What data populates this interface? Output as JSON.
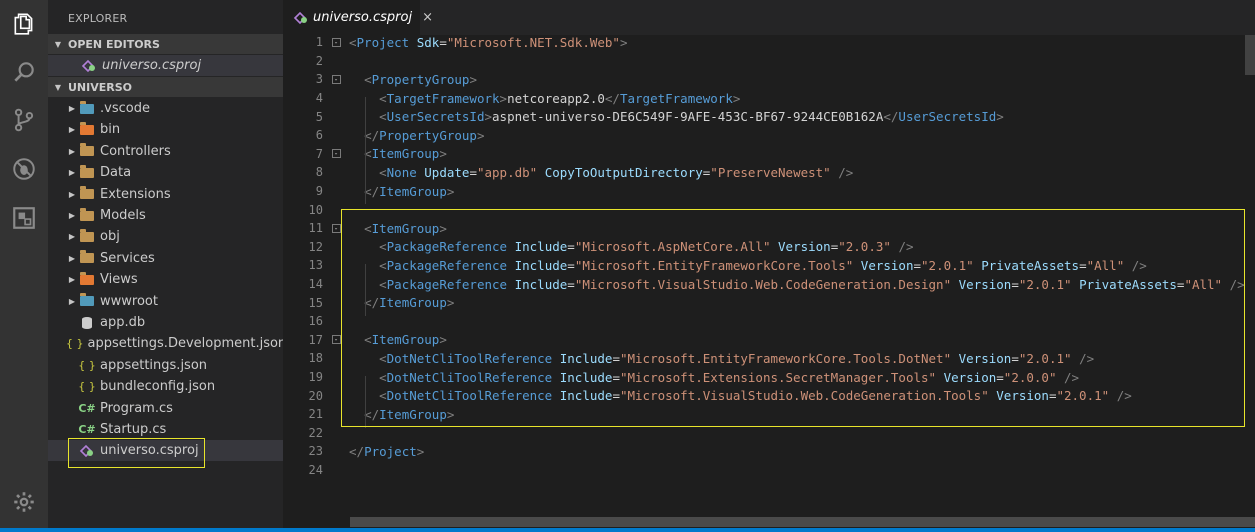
{
  "activity_bar": {
    "icons": [
      "explorer-icon",
      "search-icon",
      "source-control-icon",
      "debug-icon",
      "extensions-icon"
    ],
    "bottom_icon": "settings-gear-icon"
  },
  "sidebar": {
    "title": "EXPLORER",
    "open_editors_label": "OPEN EDITORS",
    "open_editors": [
      {
        "name": "universo.csproj"
      }
    ],
    "folder_label": "UNIVERSO",
    "tree": [
      {
        "name": ".vscode",
        "type": "folder"
      },
      {
        "name": "bin",
        "type": "folder"
      },
      {
        "name": "Controllers",
        "type": "folder"
      },
      {
        "name": "Data",
        "type": "folder"
      },
      {
        "name": "Extensions",
        "type": "folder"
      },
      {
        "name": "Models",
        "type": "folder"
      },
      {
        "name": "obj",
        "type": "folder"
      },
      {
        "name": "Services",
        "type": "folder"
      },
      {
        "name": "Views",
        "type": "folder"
      },
      {
        "name": "wwwroot",
        "type": "folder"
      },
      {
        "name": "app.db",
        "type": "file"
      },
      {
        "name": "appsettings.Development.json",
        "type": "file"
      },
      {
        "name": "appsettings.json",
        "type": "file"
      },
      {
        "name": "bundleconfig.json",
        "type": "file"
      },
      {
        "name": "Program.cs",
        "type": "file"
      },
      {
        "name": "Startup.cs",
        "type": "file"
      },
      {
        "name": "universo.csproj",
        "type": "file"
      }
    ],
    "json_icon": "{ }",
    "cs_icon": "C#"
  },
  "editor": {
    "tab_title": "universo.csproj",
    "tab_close": "×",
    "lines": [
      {
        "n": "1",
        "fold": "-",
        "code": [
          [
            "tb",
            "<"
          ],
          [
            "tn",
            "Project"
          ],
          [
            "txt",
            " "
          ],
          [
            "at",
            "Sdk"
          ],
          [
            "txt",
            "="
          ],
          [
            "av",
            "\"Microsoft.NET.Sdk.Web\""
          ],
          [
            "tb",
            ">"
          ]
        ]
      },
      {
        "n": "2",
        "code": []
      },
      {
        "n": "3",
        "fold": "-",
        "code": [
          [
            "txt",
            "  "
          ],
          [
            "tb",
            "<"
          ],
          [
            "tn",
            "PropertyGroup"
          ],
          [
            "tb",
            ">"
          ]
        ]
      },
      {
        "n": "4",
        "code": [
          [
            "txt",
            "    "
          ],
          [
            "tb",
            "<"
          ],
          [
            "tn",
            "TargetFramework"
          ],
          [
            "tb",
            ">"
          ],
          [
            "txt",
            "netcoreapp2.0"
          ],
          [
            "tb",
            "</"
          ],
          [
            "tn",
            "TargetFramework"
          ],
          [
            "tb",
            ">"
          ]
        ]
      },
      {
        "n": "5",
        "code": [
          [
            "txt",
            "    "
          ],
          [
            "tb",
            "<"
          ],
          [
            "tn",
            "UserSecretsId"
          ],
          [
            "tb",
            ">"
          ],
          [
            "txt",
            "aspnet-universo-DE6C549F-9AFE-453C-BF67-9244CE0B162A"
          ],
          [
            "tb",
            "</"
          ],
          [
            "tn",
            "UserSecretsId"
          ],
          [
            "tb",
            ">"
          ]
        ]
      },
      {
        "n": "6",
        "code": [
          [
            "txt",
            "  "
          ],
          [
            "tb",
            "</"
          ],
          [
            "tn",
            "PropertyGroup"
          ],
          [
            "tb",
            ">"
          ]
        ]
      },
      {
        "n": "7",
        "fold": "-",
        "code": [
          [
            "txt",
            "  "
          ],
          [
            "tb",
            "<"
          ],
          [
            "tn",
            "ItemGroup"
          ],
          [
            "tb",
            ">"
          ]
        ]
      },
      {
        "n": "8",
        "code": [
          [
            "txt",
            "    "
          ],
          [
            "tb",
            "<"
          ],
          [
            "tn",
            "None"
          ],
          [
            "txt",
            " "
          ],
          [
            "at",
            "Update"
          ],
          [
            "txt",
            "="
          ],
          [
            "av",
            "\"app.db\""
          ],
          [
            "txt",
            " "
          ],
          [
            "at",
            "CopyToOutputDirectory"
          ],
          [
            "txt",
            "="
          ],
          [
            "av",
            "\"PreserveNewest\""
          ],
          [
            "txt",
            " "
          ],
          [
            "tb",
            "/>"
          ]
        ]
      },
      {
        "n": "9",
        "code": [
          [
            "txt",
            "  "
          ],
          [
            "tb",
            "</"
          ],
          [
            "tn",
            "ItemGroup"
          ],
          [
            "tb",
            ">"
          ]
        ]
      },
      {
        "n": "10",
        "code": []
      },
      {
        "n": "11",
        "fold": "-",
        "code": [
          [
            "txt",
            "  "
          ],
          [
            "tb",
            "<"
          ],
          [
            "tn",
            "ItemGroup"
          ],
          [
            "tb",
            ">"
          ]
        ]
      },
      {
        "n": "12",
        "code": [
          [
            "txt",
            "    "
          ],
          [
            "tb",
            "<"
          ],
          [
            "tn",
            "PackageReference"
          ],
          [
            "txt",
            " "
          ],
          [
            "at",
            "Include"
          ],
          [
            "txt",
            "="
          ],
          [
            "av",
            "\"Microsoft.AspNetCore.All\""
          ],
          [
            "txt",
            " "
          ],
          [
            "at",
            "Version"
          ],
          [
            "txt",
            "="
          ],
          [
            "av",
            "\"2.0.3\""
          ],
          [
            "txt",
            " "
          ],
          [
            "tb",
            "/>"
          ]
        ]
      },
      {
        "n": "13",
        "code": [
          [
            "txt",
            "    "
          ],
          [
            "tb",
            "<"
          ],
          [
            "tn",
            "PackageReference"
          ],
          [
            "txt",
            " "
          ],
          [
            "at",
            "Include"
          ],
          [
            "txt",
            "="
          ],
          [
            "av",
            "\"Microsoft.EntityFrameworkCore.Tools\""
          ],
          [
            "txt",
            " "
          ],
          [
            "at",
            "Version"
          ],
          [
            "txt",
            "="
          ],
          [
            "av",
            "\"2.0.1\""
          ],
          [
            "txt",
            " "
          ],
          [
            "at",
            "PrivateAssets"
          ],
          [
            "txt",
            "="
          ],
          [
            "av",
            "\"All\""
          ],
          [
            "txt",
            " "
          ],
          [
            "tb",
            "/>"
          ]
        ]
      },
      {
        "n": "14",
        "code": [
          [
            "txt",
            "    "
          ],
          [
            "tb",
            "<"
          ],
          [
            "tn",
            "PackageReference"
          ],
          [
            "txt",
            " "
          ],
          [
            "at",
            "Include"
          ],
          [
            "txt",
            "="
          ],
          [
            "av",
            "\"Microsoft.VisualStudio.Web.CodeGeneration.Design\""
          ],
          [
            "txt",
            " "
          ],
          [
            "at",
            "Version"
          ],
          [
            "txt",
            "="
          ],
          [
            "av",
            "\"2.0.1\""
          ],
          [
            "txt",
            " "
          ],
          [
            "at",
            "PrivateAssets"
          ],
          [
            "txt",
            "="
          ],
          [
            "av",
            "\"All\""
          ],
          [
            "txt",
            " "
          ],
          [
            "tb",
            "/>"
          ]
        ]
      },
      {
        "n": "15",
        "code": [
          [
            "txt",
            "  "
          ],
          [
            "tb",
            "</"
          ],
          [
            "tn",
            "ItemGroup"
          ],
          [
            "tb",
            ">"
          ]
        ]
      },
      {
        "n": "16",
        "code": []
      },
      {
        "n": "17",
        "fold": "-",
        "code": [
          [
            "txt",
            "  "
          ],
          [
            "tb",
            "<"
          ],
          [
            "tn",
            "ItemGroup"
          ],
          [
            "tb",
            ">"
          ]
        ]
      },
      {
        "n": "18",
        "code": [
          [
            "txt",
            "    "
          ],
          [
            "tb",
            "<"
          ],
          [
            "tn",
            "DotNetCliToolReference"
          ],
          [
            "txt",
            " "
          ],
          [
            "at",
            "Include"
          ],
          [
            "txt",
            "="
          ],
          [
            "av",
            "\"Microsoft.EntityFrameworkCore.Tools.DotNet\""
          ],
          [
            "txt",
            " "
          ],
          [
            "at",
            "Version"
          ],
          [
            "txt",
            "="
          ],
          [
            "av",
            "\"2.0.1\""
          ],
          [
            "txt",
            " "
          ],
          [
            "tb",
            "/>"
          ]
        ]
      },
      {
        "n": "19",
        "code": [
          [
            "txt",
            "    "
          ],
          [
            "tb",
            "<"
          ],
          [
            "tn",
            "DotNetCliToolReference"
          ],
          [
            "txt",
            " "
          ],
          [
            "at",
            "Include"
          ],
          [
            "txt",
            "="
          ],
          [
            "av",
            "\"Microsoft.Extensions.SecretManager.Tools\""
          ],
          [
            "txt",
            " "
          ],
          [
            "at",
            "Version"
          ],
          [
            "txt",
            "="
          ],
          [
            "av",
            "\"2.0.0\""
          ],
          [
            "txt",
            " "
          ],
          [
            "tb",
            "/>"
          ]
        ]
      },
      {
        "n": "20",
        "code": [
          [
            "txt",
            "    "
          ],
          [
            "tb",
            "<"
          ],
          [
            "tn",
            "DotNetCliToolReference"
          ],
          [
            "txt",
            " "
          ],
          [
            "at",
            "Include"
          ],
          [
            "txt",
            "="
          ],
          [
            "av",
            "\"Microsoft.VisualStudio.Web.CodeGeneration.Tools\""
          ],
          [
            "txt",
            " "
          ],
          [
            "at",
            "Version"
          ],
          [
            "txt",
            "="
          ],
          [
            "av",
            "\"2.0.1\""
          ],
          [
            "txt",
            " "
          ],
          [
            "tb",
            "/>"
          ]
        ]
      },
      {
        "n": "21",
        "code": [
          [
            "txt",
            "  "
          ],
          [
            "tb",
            "</"
          ],
          [
            "tn",
            "ItemGroup"
          ],
          [
            "tb",
            ">"
          ]
        ]
      },
      {
        "n": "22",
        "code": []
      },
      {
        "n": "23",
        "code": [
          [
            "tb",
            "</"
          ],
          [
            "tn",
            "Project"
          ],
          [
            "tb",
            ">"
          ]
        ]
      },
      {
        "n": "24",
        "code": []
      }
    ]
  },
  "colors": {
    "activity_bar": "#333333",
    "sidebar": "#252526",
    "editor": "#1e1e1e",
    "highlight_box": "#e8e52b",
    "status_bar": "#007acc"
  }
}
